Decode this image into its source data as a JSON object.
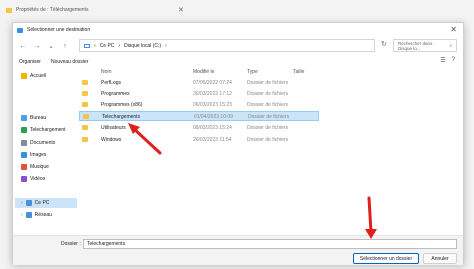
{
  "background_window": {
    "title": "Propriétés de : Téléchargements"
  },
  "dialog": {
    "title": "Sélectionner une destination",
    "breadcrumb": [
      "Ce PC",
      "Disque local (C:)"
    ],
    "search_placeholder": "Rechercher dans : Disque lo...",
    "toolbar": {
      "organize": "Organiser",
      "new_folder": "Nouveau dossier"
    },
    "columns": {
      "name": "Nom",
      "modified": "Modifié le",
      "type": "Type",
      "size": "Taille"
    },
    "rows": [
      {
        "name": "PerfLogs",
        "modified": "07/05/2022 07:24",
        "type": "Dossier de fichiers"
      },
      {
        "name": "Programmes",
        "modified": "30/03/2023 17:12",
        "type": "Dossier de fichiers"
      },
      {
        "name": "Programmes (x86)",
        "modified": "06/03/2023 15:23",
        "type": "Dossier de fichiers"
      },
      {
        "name": "Telechargements",
        "modified": "01/04/2023 10:09",
        "type": "Dossier de fichiers"
      },
      {
        "name": "Utilisateurs",
        "modified": "08/03/2023 15:24",
        "type": "Dossier de fichiers"
      },
      {
        "name": "Windows",
        "modified": "26/03/2023 11:54",
        "type": "Dossier de fichiers"
      }
    ],
    "sidebar": {
      "home": "Accueil",
      "items": [
        "Bureau",
        "Telechargement",
        "Documents",
        "Images",
        "Musique",
        "Vidéos"
      ],
      "this_pc": "Ce PC",
      "network": "Réseau"
    },
    "folder_label": "Dossier :",
    "folder_value": "Telechargements",
    "select_button": "Sélectionner un dossier",
    "cancel_button": "Annuler"
  },
  "colors": {
    "selection": "#cce4f7",
    "accent": "#0067c0",
    "annotation_arrow": "#e0201b",
    "folder": "#f5c543"
  }
}
